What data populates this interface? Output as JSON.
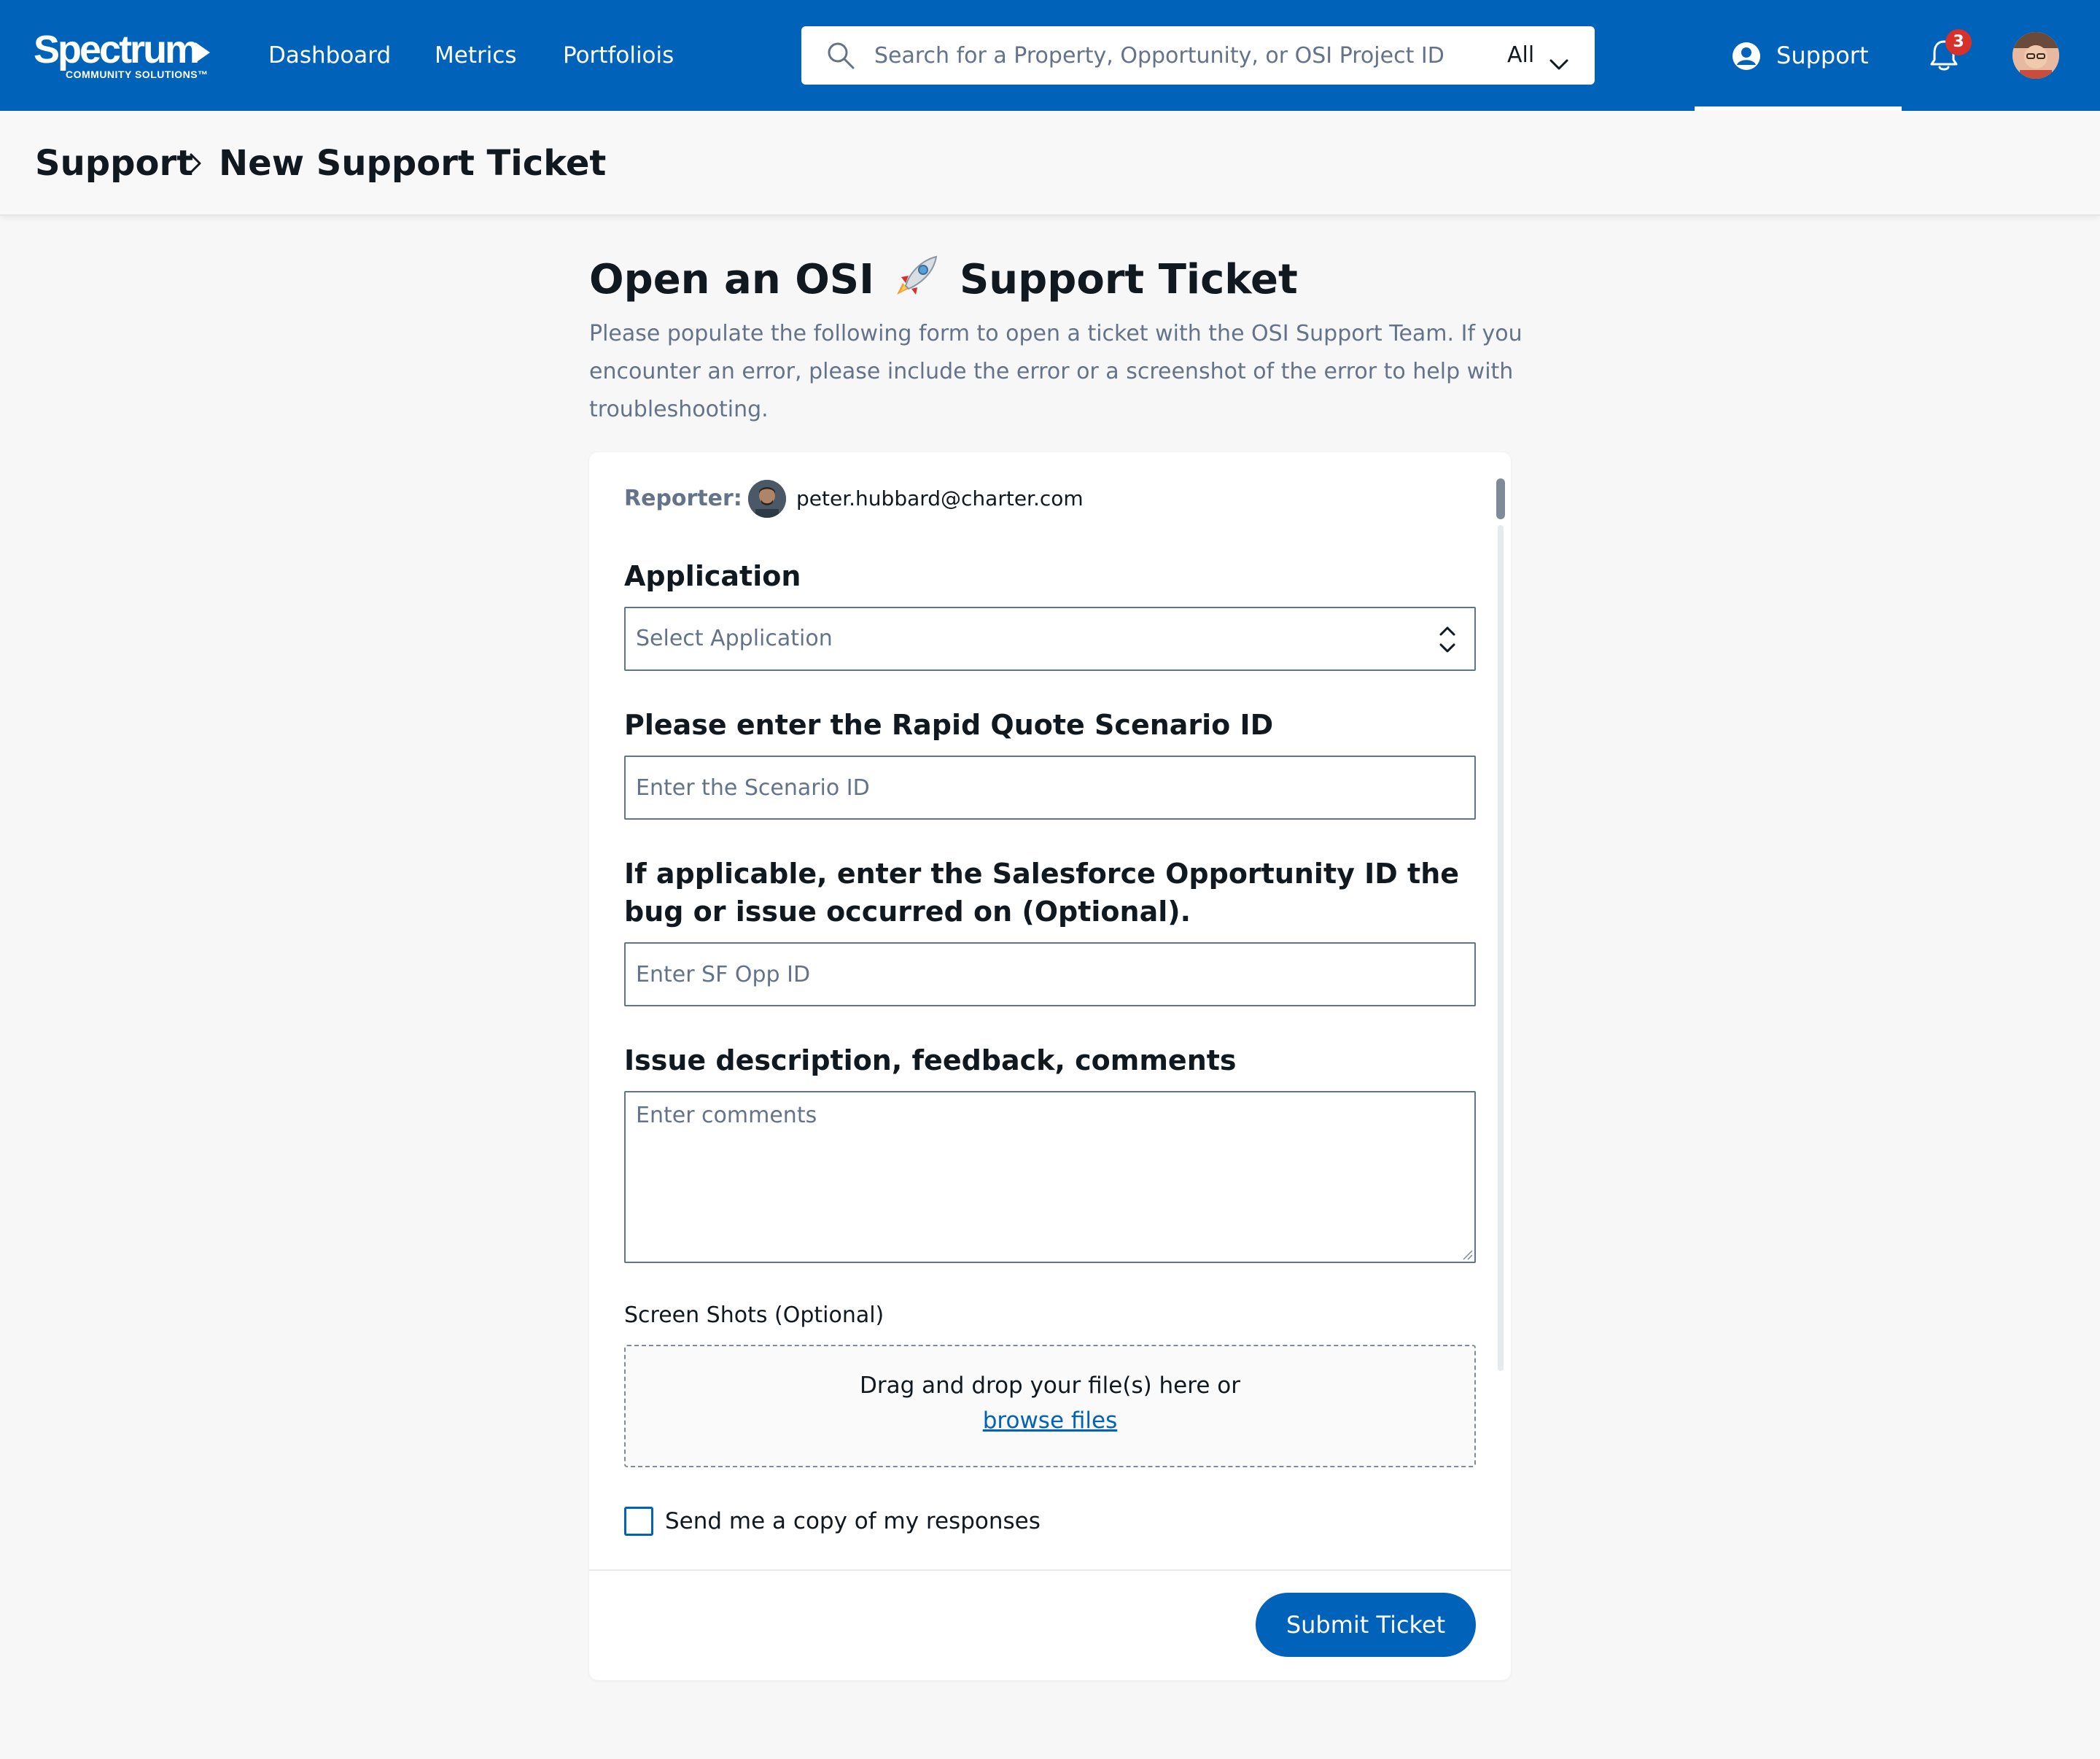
{
  "brand": {
    "name": "Spectrum",
    "tagline": "COMMUNITY SOLUTIONS™",
    "primary_color": "#0062b8"
  },
  "nav": {
    "links": [
      {
        "label": "Dashboard"
      },
      {
        "label": "Metrics"
      },
      {
        "label": "Portfoliois"
      }
    ],
    "search": {
      "placeholder": "Search for a Property, Opportunity, or OSI Project ID",
      "scope": "All",
      "icon": "search-icon"
    },
    "support": {
      "label": "Support",
      "icon": "support-icon",
      "active": true
    },
    "notifications": {
      "count": "3",
      "icon": "bell-icon",
      "badge_color": "#d6312b"
    }
  },
  "breadcrumb": {
    "items": [
      "Support",
      "New Support Ticket"
    ]
  },
  "page": {
    "title_prefix": "Open an OSI",
    "title_suffix": "Support Ticket",
    "title_icon": "rocket-icon",
    "intro": "Please populate the following form to open a ticket with the OSI Support Team. If you encounter an error, please include the error or a screenshot of the error to help with troubleshooting."
  },
  "form": {
    "reporter_label": "Reporter:",
    "reporter_email": "peter.hubbard@charter.com",
    "application": {
      "label": "Application",
      "value": "Select Application"
    },
    "scenario": {
      "label": "Please enter the Rapid Quote Scenario ID",
      "placeholder": "Enter the Scenario ID"
    },
    "sf_opp": {
      "label": "If applicable, enter the Salesforce Opportunity ID the bug or issue occurred on (Optional).",
      "placeholder": "Enter SF Opp ID"
    },
    "comments": {
      "label": "Issue description, feedback, comments",
      "placeholder": "Enter comments"
    },
    "screenshots": {
      "label": "Screen Shots (Optional)",
      "drop_text": "Drag and drop your file(s) here or",
      "browse_link": "browse files"
    },
    "copy_checkbox": {
      "label": "Send me a copy of my responses",
      "checked": false
    },
    "submit_label": "Submit Ticket"
  }
}
